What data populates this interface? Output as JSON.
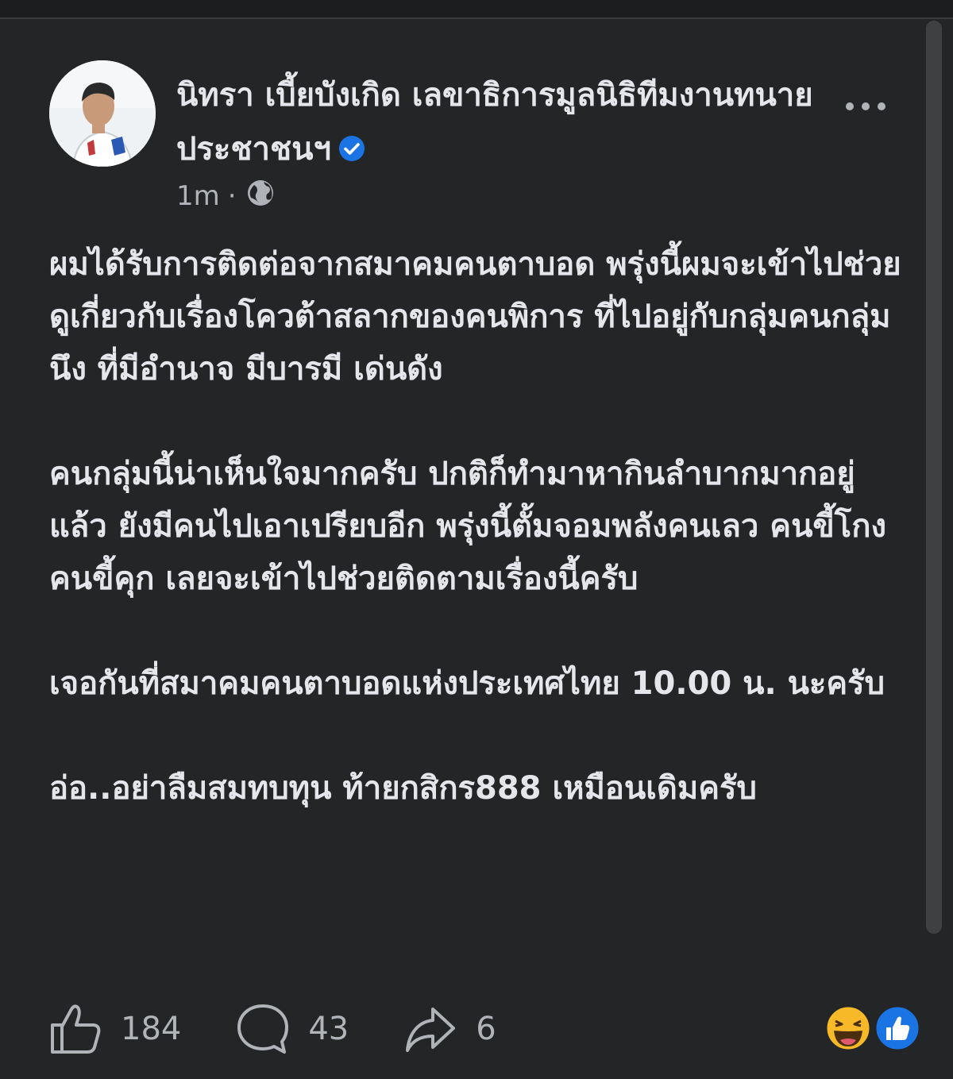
{
  "post": {
    "author_name": "นิทรา เบี้ยบังเกิด เลขาธิการมูลนิธิทีมงานทนายประชาชนฯ",
    "timestamp": "1m",
    "separator": "·",
    "privacy_icon": "globe-icon",
    "verified_icon": "verified-badge-icon",
    "more_icon": "more-options-icon",
    "paragraphs": [
      "ผมได้รับการติดต่อจากสมาคมคนตาบอด พรุ่งนี้ผมจะเข้าไปช่วยดูเกี่ยวกับเรื่องโควต้าสลากของคนพิการ ที่ไปอยู่กับกลุ่มคนกลุ่มนึง ที่มีอำนาจ มีบารมี เด่นดัง",
      "คนกลุ่มนี้น่าเห็นใจมากครับ ปกติก็ทำมาหากินลำบากมากอยู่แล้ว ยังมีคนไปเอาเปรียบอีก พรุ่งนี้ตั้มจอมพลังคนเลว คนขี้โกง คนขี้คุก เลยจะเข้าไปช่วยติดตามเรื่องนี้ครับ",
      "เจอกันที่สมาคมคนตาบอดแห่งประเทศไทย 10.00 น. นะครับ",
      "อ่อ..อย่าลืมสมทบทุน ท้ายกสิกร888 เหมือนเดิมครับ"
    ]
  },
  "actions": {
    "like_count": "184",
    "comment_count": "43",
    "share_count": "6"
  },
  "reactions": [
    "laughing-reaction-icon",
    "like-reaction-icon"
  ],
  "colors": {
    "background": "#242526",
    "text": "#e4e6eb",
    "secondary_text": "#b0b3b8",
    "verified_blue": "#1b74e4"
  }
}
